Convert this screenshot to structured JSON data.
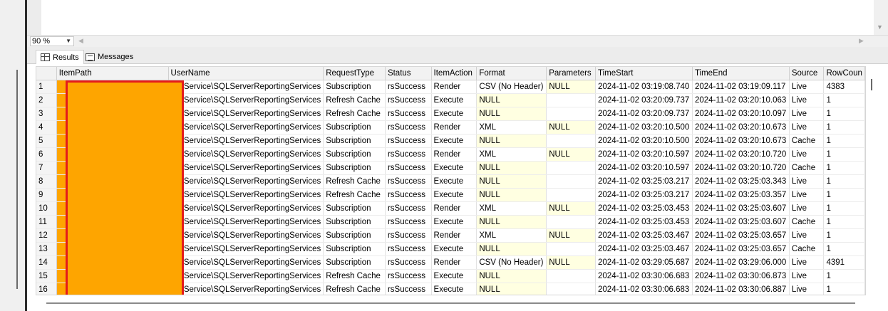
{
  "zoom": {
    "value": "90 %"
  },
  "tabs": {
    "results": "Results",
    "messages": "Messages"
  },
  "grid": {
    "columns": [
      "",
      "ItemPath",
      "UserName",
      "RequestType",
      "Status",
      "ItemAction",
      "Format",
      "Parameters",
      "TimeStart",
      "TimeEnd",
      "Source",
      "RowCoun"
    ],
    "rows": [
      [
        "1",
        "",
        "NT Service\\SQLServerReportingServices",
        "Subscription",
        "rsSuccess",
        "Render",
        "CSV (No Header)",
        "NULL",
        "2024-11-02 03:19:08.740",
        "2024-11-02 03:19:09.117",
        "Live",
        "4383"
      ],
      [
        "2",
        "",
        "NT Service\\SQLServerReportingServices",
        "Refresh Cache",
        "rsSuccess",
        "Execute",
        "NULL",
        "",
        "2024-11-02 03:20:09.737",
        "2024-11-02 03:20:10.063",
        "Live",
        "1"
      ],
      [
        "3",
        "",
        "NT Service\\SQLServerReportingServices",
        "Refresh Cache",
        "rsSuccess",
        "Execute",
        "NULL",
        "",
        "2024-11-02 03:20:09.737",
        "2024-11-02 03:20:10.097",
        "Live",
        "1"
      ],
      [
        "4",
        "",
        "NT Service\\SQLServerReportingServices",
        "Subscription",
        "rsSuccess",
        "Render",
        "XML",
        "NULL",
        "2024-11-02 03:20:10.500",
        "2024-11-02 03:20:10.673",
        "Live",
        "1"
      ],
      [
        "5",
        "",
        "NT Service\\SQLServerReportingServices",
        "Subscription",
        "rsSuccess",
        "Execute",
        "NULL",
        "",
        "2024-11-02 03:20:10.500",
        "2024-11-02 03:20:10.673",
        "Cache",
        "1"
      ],
      [
        "6",
        "",
        "NT Service\\SQLServerReportingServices",
        "Subscription",
        "rsSuccess",
        "Render",
        "XML",
        "NULL",
        "2024-11-02 03:20:10.597",
        "2024-11-02 03:20:10.720",
        "Live",
        "1"
      ],
      [
        "7",
        "",
        "NT Service\\SQLServerReportingServices",
        "Subscription",
        "rsSuccess",
        "Execute",
        "NULL",
        "",
        "2024-11-02 03:20:10.597",
        "2024-11-02 03:20:10.720",
        "Cache",
        "1"
      ],
      [
        "8",
        "",
        "NT Service\\SQLServerReportingServices",
        "Refresh Cache",
        "rsSuccess",
        "Execute",
        "NULL",
        "",
        "2024-11-02 03:25:03.217",
        "2024-11-02 03:25:03.343",
        "Live",
        "1"
      ],
      [
        "9",
        "",
        "NT Service\\SQLServerReportingServices",
        "Refresh Cache",
        "rsSuccess",
        "Execute",
        "NULL",
        "",
        "2024-11-02 03:25:03.217",
        "2024-11-02 03:25:03.357",
        "Live",
        "1"
      ],
      [
        "10",
        "",
        "NT Service\\SQLServerReportingServices",
        "Subscription",
        "rsSuccess",
        "Render",
        "XML",
        "NULL",
        "2024-11-02 03:25:03.453",
        "2024-11-02 03:25:03.607",
        "Live",
        "1"
      ],
      [
        "11",
        "",
        "NT Service\\SQLServerReportingServices",
        "Subscription",
        "rsSuccess",
        "Execute",
        "NULL",
        "",
        "2024-11-02 03:25:03.453",
        "2024-11-02 03:25:03.607",
        "Cache",
        "1"
      ],
      [
        "12",
        "",
        "NT Service\\SQLServerReportingServices",
        "Subscription",
        "rsSuccess",
        "Render",
        "XML",
        "NULL",
        "2024-11-02 03:25:03.467",
        "2024-11-02 03:25:03.657",
        "Live",
        "1"
      ],
      [
        "13",
        "",
        "NT Service\\SQLServerReportingServices",
        "Subscription",
        "rsSuccess",
        "Execute",
        "NULL",
        "",
        "2024-11-02 03:25:03.467",
        "2024-11-02 03:25:03.657",
        "Cache",
        "1"
      ],
      [
        "14",
        "",
        "NT Service\\SQLServerReportingServices",
        "Subscription",
        "rsSuccess",
        "Render",
        "CSV (No Header)",
        "NULL",
        "2024-11-02 03:29:05.687",
        "2024-11-02 03:29:06.000",
        "Live",
        "4391"
      ],
      [
        "15",
        "",
        "NT Service\\SQLServerReportingServices",
        "Refresh Cache",
        "rsSuccess",
        "Execute",
        "NULL",
        "",
        "2024-11-02 03:30:06.683",
        "2024-11-02 03:30:06.873",
        "Live",
        "1"
      ],
      [
        "16",
        "",
        "NT Service\\SQLServerReportingServices",
        "Refresh Cache",
        "rsSuccess",
        "Execute",
        "NULL",
        "",
        "2024-11-02 03:30:06.683",
        "2024-11-02 03:30:06.887",
        "Live",
        "1"
      ]
    ]
  },
  "colors": {
    "null_cell": "#ffffe1",
    "redaction_fill": "#fea500",
    "redaction_border": "#e41b1b"
  }
}
